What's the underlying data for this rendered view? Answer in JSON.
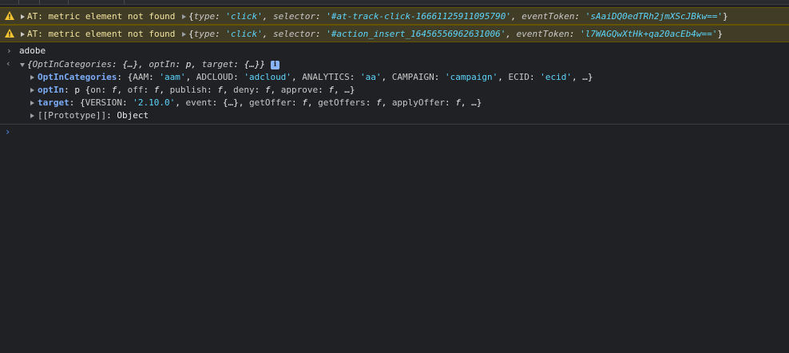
{
  "warnings": [
    {
      "message": "AT: metric element not found",
      "object": {
        "type_key": "type",
        "type_val": "'click'",
        "sel_key": "selector",
        "sel_val": "'#at-track-click-16661125911095790'",
        "tok_key": "eventToken",
        "tok_val": "'sAaiDQ0edTRh2jmXScJBkw=='"
      }
    },
    {
      "message": "AT: metric element not found",
      "object": {
        "type_key": "type",
        "type_val": "'click'",
        "sel_key": "selector",
        "sel_val": "'#action_insert_16456556962631006'",
        "tok_key": "eventToken",
        "tok_val": "'l7WAGQwXtHk+qa20acEb4w=='"
      }
    }
  ],
  "input_command": "adobe",
  "result": {
    "summary": {
      "k1": "OptInCategories",
      "v1": "{…}",
      "k2": "optIn",
      "v2": "p",
      "k3": "target",
      "v3": "{…}"
    },
    "info_badge": "i",
    "props": [
      {
        "key": "OptInCategories",
        "parts": [
          "AAM",
          "'aam'",
          "ADCLOUD",
          "'adcloud'",
          "ANALYTICS",
          "'aa'",
          "CAMPAIGN",
          "'campaign'",
          "ECID",
          "'ecid'"
        ],
        "ellipsis": "…"
      },
      {
        "key": "optIn",
        "prefix": "p",
        "parts": [
          "on",
          "f",
          "off",
          "f",
          "publish",
          "f",
          "deny",
          "f",
          "approve",
          "f"
        ],
        "ellipsis": "…"
      },
      {
        "key": "target",
        "parts": [
          "VERSION",
          "'2.10.0'",
          "event",
          "{…}",
          "getOffer",
          "f",
          "getOffers",
          "f",
          "applyOffer",
          "f"
        ],
        "ellipsis": "…"
      }
    ],
    "prototype": {
      "key": "[[Prototype]]",
      "value": "Object"
    }
  },
  "prompt_symbol": "›",
  "colors": {
    "warning_bg": "#413c26",
    "string": "#5cd5fb",
    "key_bold": "#7cacf8",
    "background": "#202124"
  }
}
